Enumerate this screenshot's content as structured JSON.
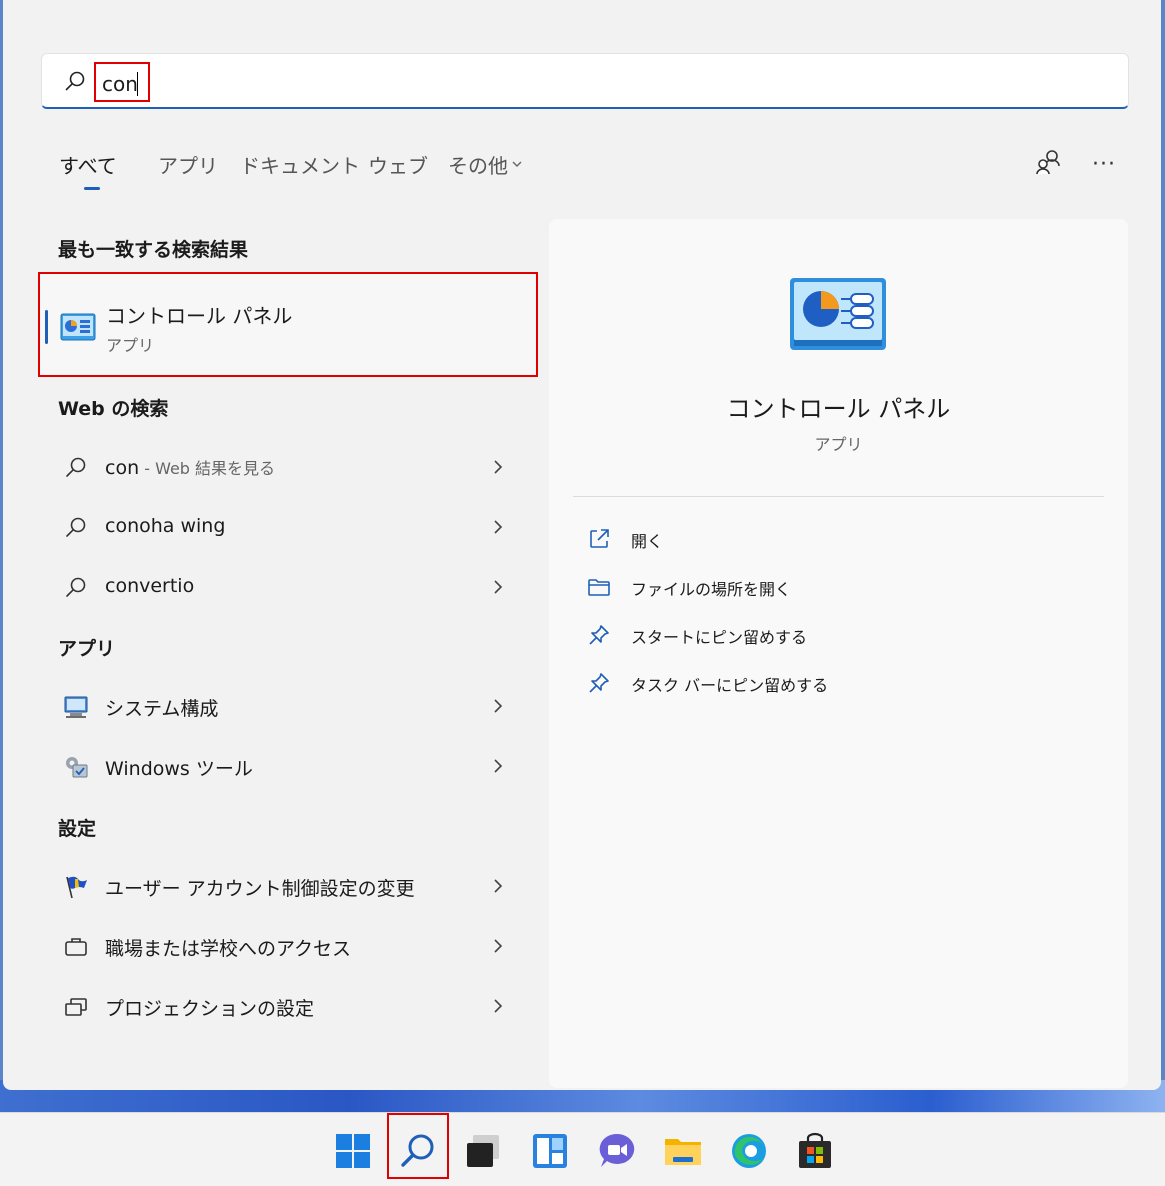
{
  "search": {
    "value": "con"
  },
  "tabs": [
    {
      "label": "すべて"
    },
    {
      "label": "アプリ"
    },
    {
      "label": "ドキュメント"
    },
    {
      "label": "ウェブ"
    },
    {
      "label": "その他"
    }
  ],
  "toolbar": {
    "more_label": "···"
  },
  "sections": {
    "best_match": "最も一致する検索結果",
    "web": "Web の検索",
    "apps": "アプリ",
    "settings": "設定"
  },
  "best_match": {
    "title": "コントロール パネル",
    "subtitle": "アプリ"
  },
  "web_results": [
    {
      "label": "con",
      "sub": " - Web 結果を見る"
    },
    {
      "label": "conoha wing"
    },
    {
      "label": "convertio"
    }
  ],
  "app_results": [
    {
      "label": "システム構成"
    },
    {
      "label": "Windows ツール"
    }
  ],
  "settings_results": [
    {
      "label": "ユーザー アカウント制御設定の変更"
    },
    {
      "label": "職場または学校へのアクセス"
    },
    {
      "label": "プロジェクションの設定"
    }
  ],
  "preview": {
    "title": "コントロール パネル",
    "subtitle": "アプリ",
    "actions": [
      {
        "label": "開く",
        "icon": "open-icon"
      },
      {
        "label": "ファイルの場所を開く",
        "icon": "folder-icon"
      },
      {
        "label": "スタートにピン留めする",
        "icon": "pin-icon"
      },
      {
        "label": "タスク バーにピン留めする",
        "icon": "pin-icon"
      }
    ]
  },
  "colors": {
    "accent": "#1f5fb8",
    "highlight": "#e00000"
  },
  "taskbar": [
    "windows-start-icon",
    "search-icon",
    "task-view-icon",
    "widgets-icon",
    "chat-icon",
    "file-explorer-icon",
    "edge-icon",
    "store-icon"
  ]
}
